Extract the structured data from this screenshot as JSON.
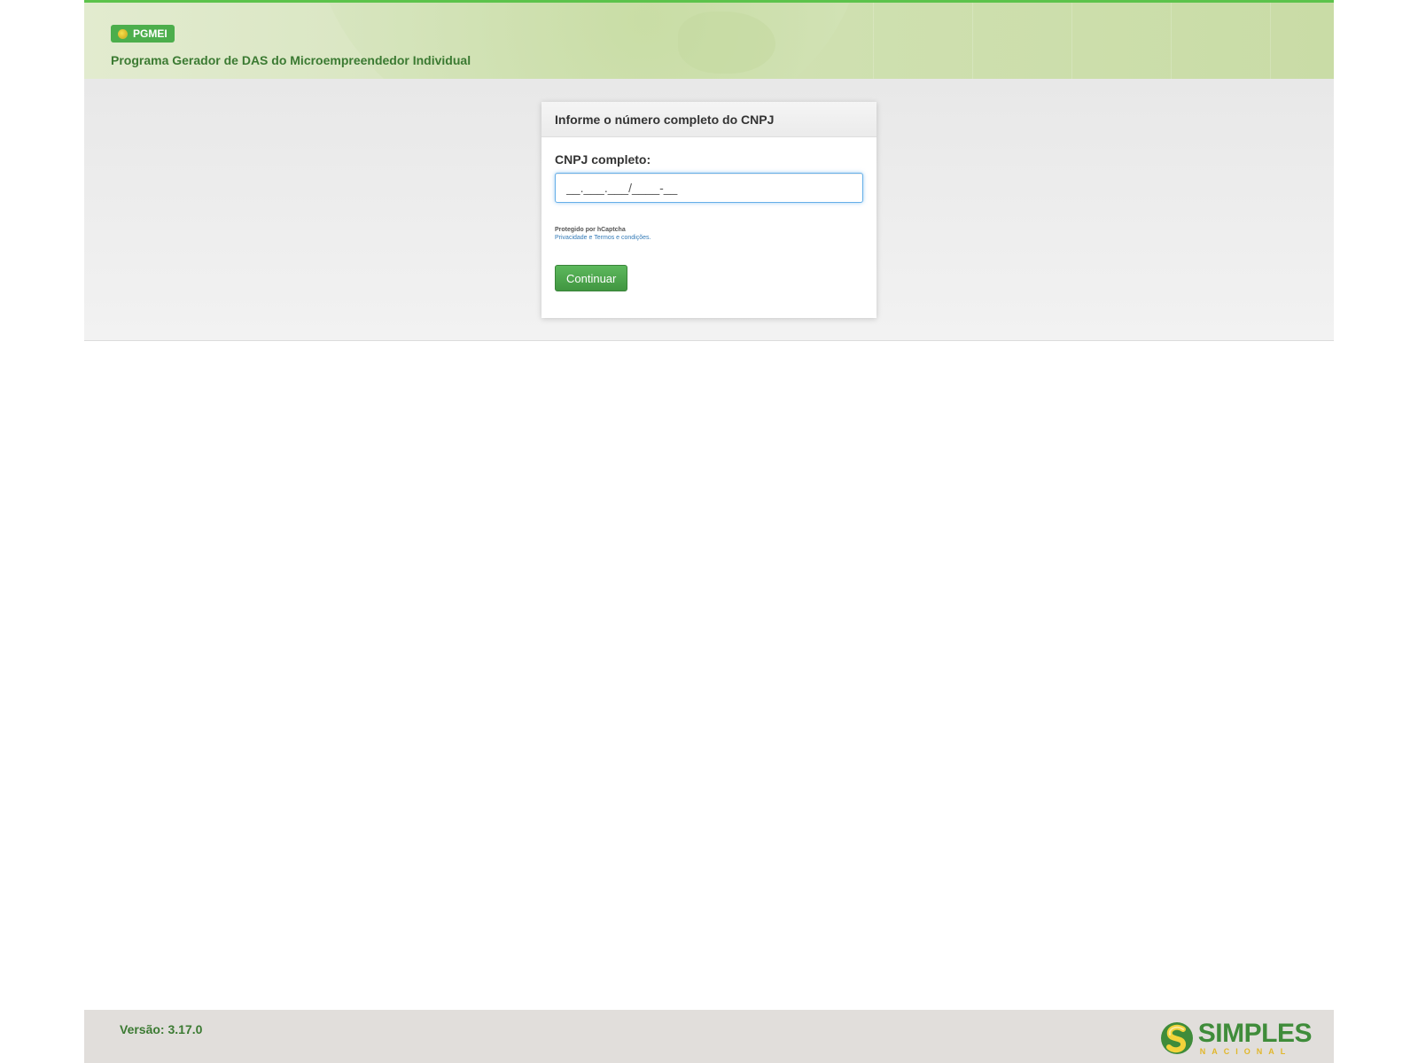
{
  "header": {
    "badge_label": "PGMEI",
    "title": "Programa Gerador de DAS do Microempreendedor Individual"
  },
  "card": {
    "title": "Informe o número completo do CNPJ",
    "cnpj_label": "CNPJ completo:",
    "cnpj_value": "",
    "cnpj_placeholder": "__.___.___/____-__",
    "captcha_protected": "Protegido por hCaptcha",
    "captcha_privacy": "Privacidade",
    "captcha_sep": "e",
    "captcha_terms": "Termos e condições.",
    "continue_label": "Continuar"
  },
  "footer": {
    "version": "Versão: 3.17.0",
    "logo_main": "SIMPLES",
    "logo_sub": "NACIONAL"
  },
  "colors": {
    "accent_green": "#5cc34b",
    "title_green": "#3b7a32",
    "button_green": "#4cae4c",
    "link_blue": "#337ab7",
    "logo_yellow": "#e1b72a"
  },
  "icons": {
    "badge_icon": "simples-s-icon",
    "logo_icon": "simples-nacional-logo-icon"
  }
}
